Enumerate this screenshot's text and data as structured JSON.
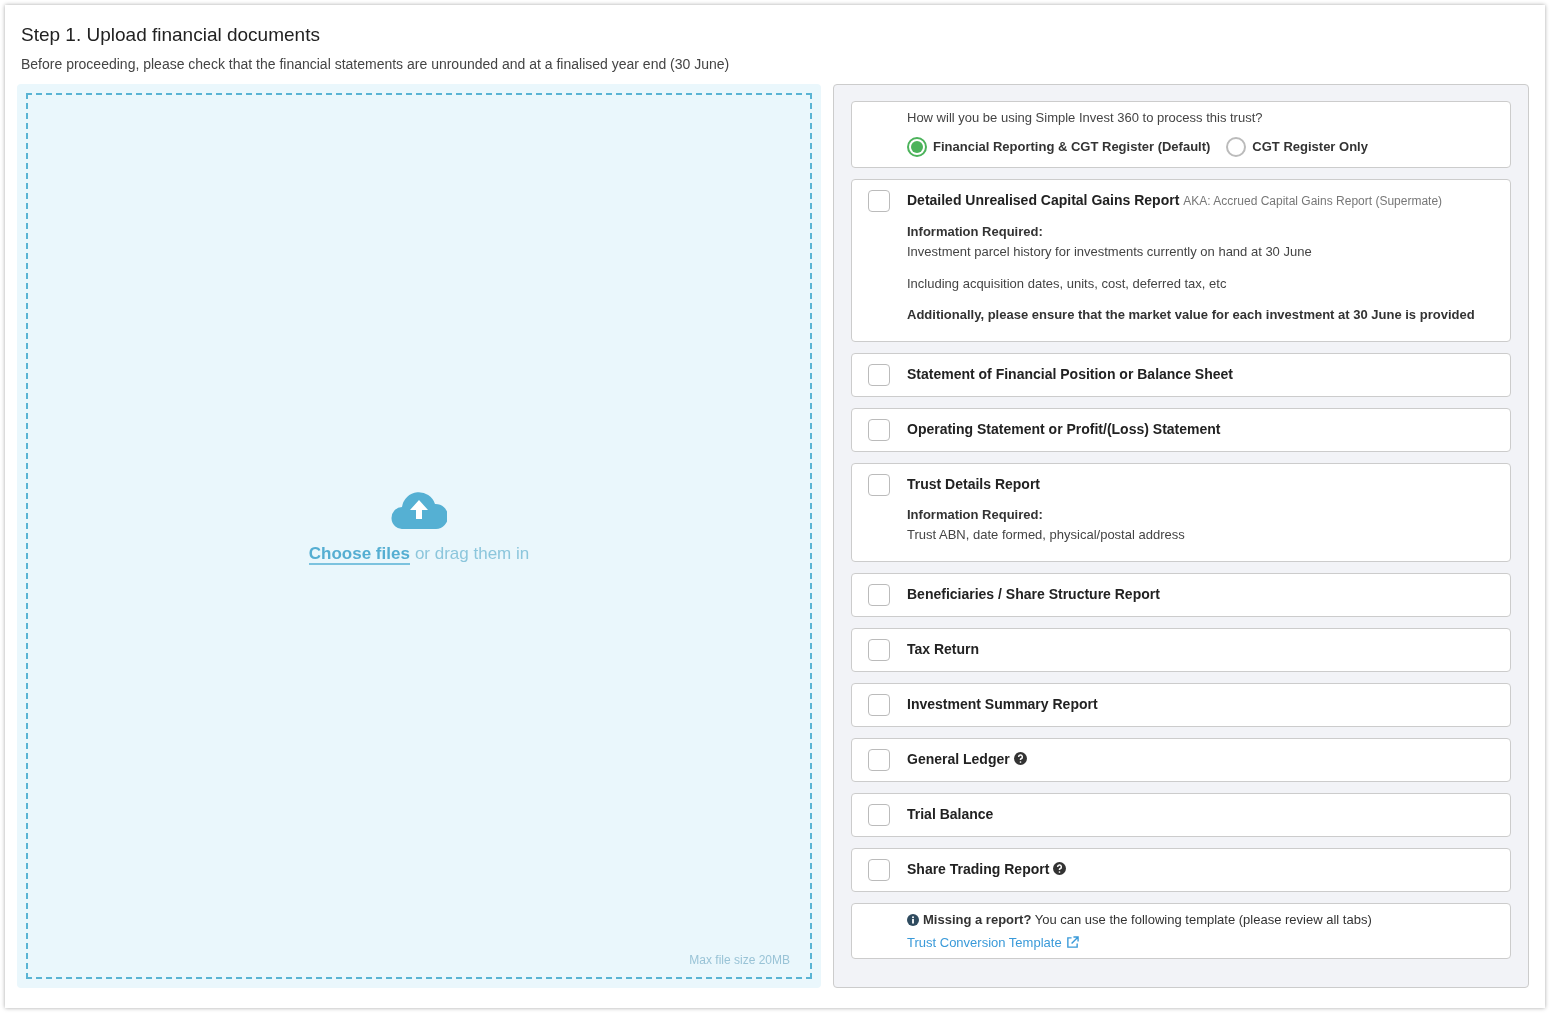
{
  "header": {
    "title": "Step 1. Upload financial documents",
    "subtitle": "Before proceeding, please check that the financial statements are unrounded and at a finalised year end (30 June)"
  },
  "dropzone": {
    "link": "Choose files",
    "text": "or drag them in",
    "note": "Max file size 20MB"
  },
  "usage": {
    "question": "How will you be using Simple Invest 360 to process this trust?",
    "options": [
      {
        "label": "Financial Reporting & CGT Register (Default)",
        "selected": true
      },
      {
        "label": "CGT Register Only",
        "selected": false
      }
    ]
  },
  "reports": [
    {
      "title": "Detailed Unrealised Capital Gains Report",
      "aka": "AKA: Accrued Capital Gains Report (Supermate)",
      "checked": false,
      "help": false,
      "details": [
        {
          "kind": "label",
          "text": "Information Required:"
        },
        {
          "kind": "text",
          "text": "Investment parcel history for investments currently on hand at 30 June"
        },
        {
          "kind": "gap_text",
          "text": "Including acquisition dates, units, cost, deferred tax, etc"
        },
        {
          "kind": "note",
          "text": "Additionally, please ensure that the market value for each investment at 30 June is provided"
        }
      ]
    },
    {
      "title": "Statement of Financial Position or Balance Sheet",
      "checked": false,
      "help": false
    },
    {
      "title": "Operating Statement or Profit/(Loss) Statement",
      "checked": false,
      "help": false
    },
    {
      "title": "Trust Details Report",
      "checked": false,
      "help": false,
      "details": [
        {
          "kind": "label",
          "text": "Information Required:"
        },
        {
          "kind": "text",
          "text": "Trust ABN, date formed, physical/postal address"
        }
      ]
    },
    {
      "title": "Beneficiaries / Share Structure Report",
      "checked": false,
      "help": false
    },
    {
      "title": "Tax Return",
      "checked": false,
      "help": false
    },
    {
      "title": "Investment Summary Report",
      "checked": false,
      "help": false
    },
    {
      "title": "General Ledger",
      "checked": false,
      "help": true
    },
    {
      "title": "Trial Balance",
      "checked": false,
      "help": false
    },
    {
      "title": "Share Trading Report",
      "checked": false,
      "help": true
    }
  ],
  "missing": {
    "text": "**Missing a report?** You can use the following template (please review all tabs)",
    "link": "Trust Conversion Template"
  }
}
